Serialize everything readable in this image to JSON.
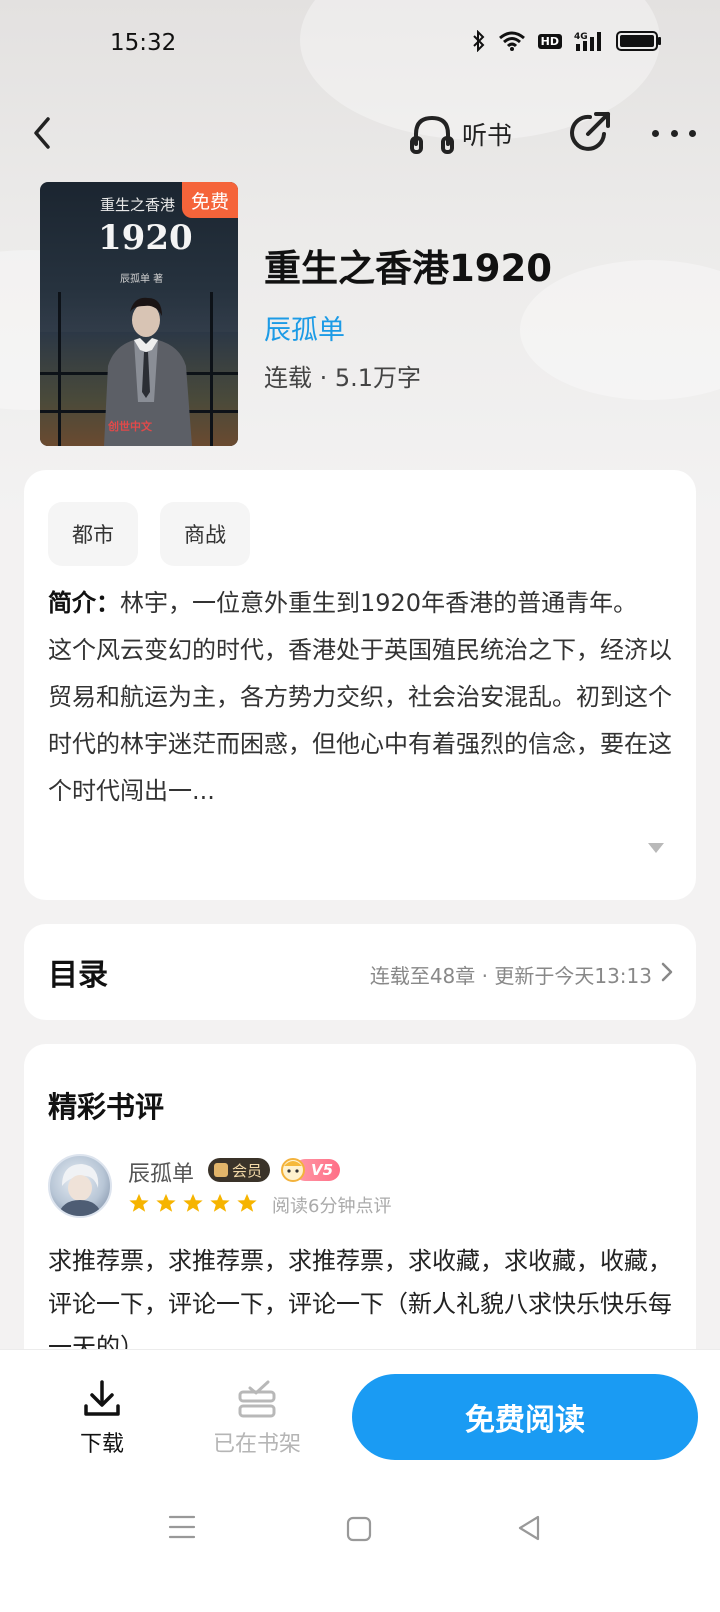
{
  "status_bar": {
    "time": "15:32",
    "icons": [
      "bluetooth-icon",
      "wifi-icon",
      "hd-icon",
      "signal-4g-icon",
      "battery-icon"
    ],
    "hd_label": "HD"
  },
  "nav": {
    "back_icon": "back-arrow-icon",
    "listen_label": "听书",
    "listen_icon": "headphones-icon",
    "share_icon": "share-icon",
    "more_icon": "more-dots-icon"
  },
  "book": {
    "cover": {
      "small_title": "重生之香港",
      "big_title": "1920",
      "author_line": "辰孤单 著",
      "logo": "创世中文"
    },
    "free_badge": "免费",
    "title": "重生之香港1920",
    "author": "辰孤单",
    "meta": "连载 · 5.1万字"
  },
  "intro": {
    "tags": [
      "都市",
      "商战"
    ],
    "label": "简介：",
    "para1": "林宇，一位意外重生到1920年香港的普通青年。",
    "para2": "这个风云变幻的时代，香港处于英国殖民统治之下，经济以贸易和航运为主，各方势力交织，社会治安混乱。初到这个时代的林宇迷茫而困惑，但他心中有着强烈的信念，要在这个时代闯出一...",
    "expand_icon": "expand-down-icon"
  },
  "toc": {
    "title": "目录",
    "status": "连载至48章 · 更新于今天13:13"
  },
  "reviews": {
    "title": "精彩书评",
    "items": [
      {
        "name": "辰孤单",
        "member_badge": "会员",
        "level_badge": "V5",
        "stars": 5,
        "hint": "阅读6分钟点评",
        "text": "求推荐票，求推荐票，求推荐票，求收藏，求收藏，收藏，评论一下，评论一下，评论一下（新人礼貌八求快乐快乐每一天的）"
      }
    ]
  },
  "actions": {
    "download_label": "下载",
    "shelf_label": "已在书架",
    "read_label": "免费阅读"
  },
  "colors": {
    "accent": "#1a9bf3",
    "author_link": "#1c9be6",
    "free_badge": "#f5643a",
    "star": "#f6b400"
  }
}
